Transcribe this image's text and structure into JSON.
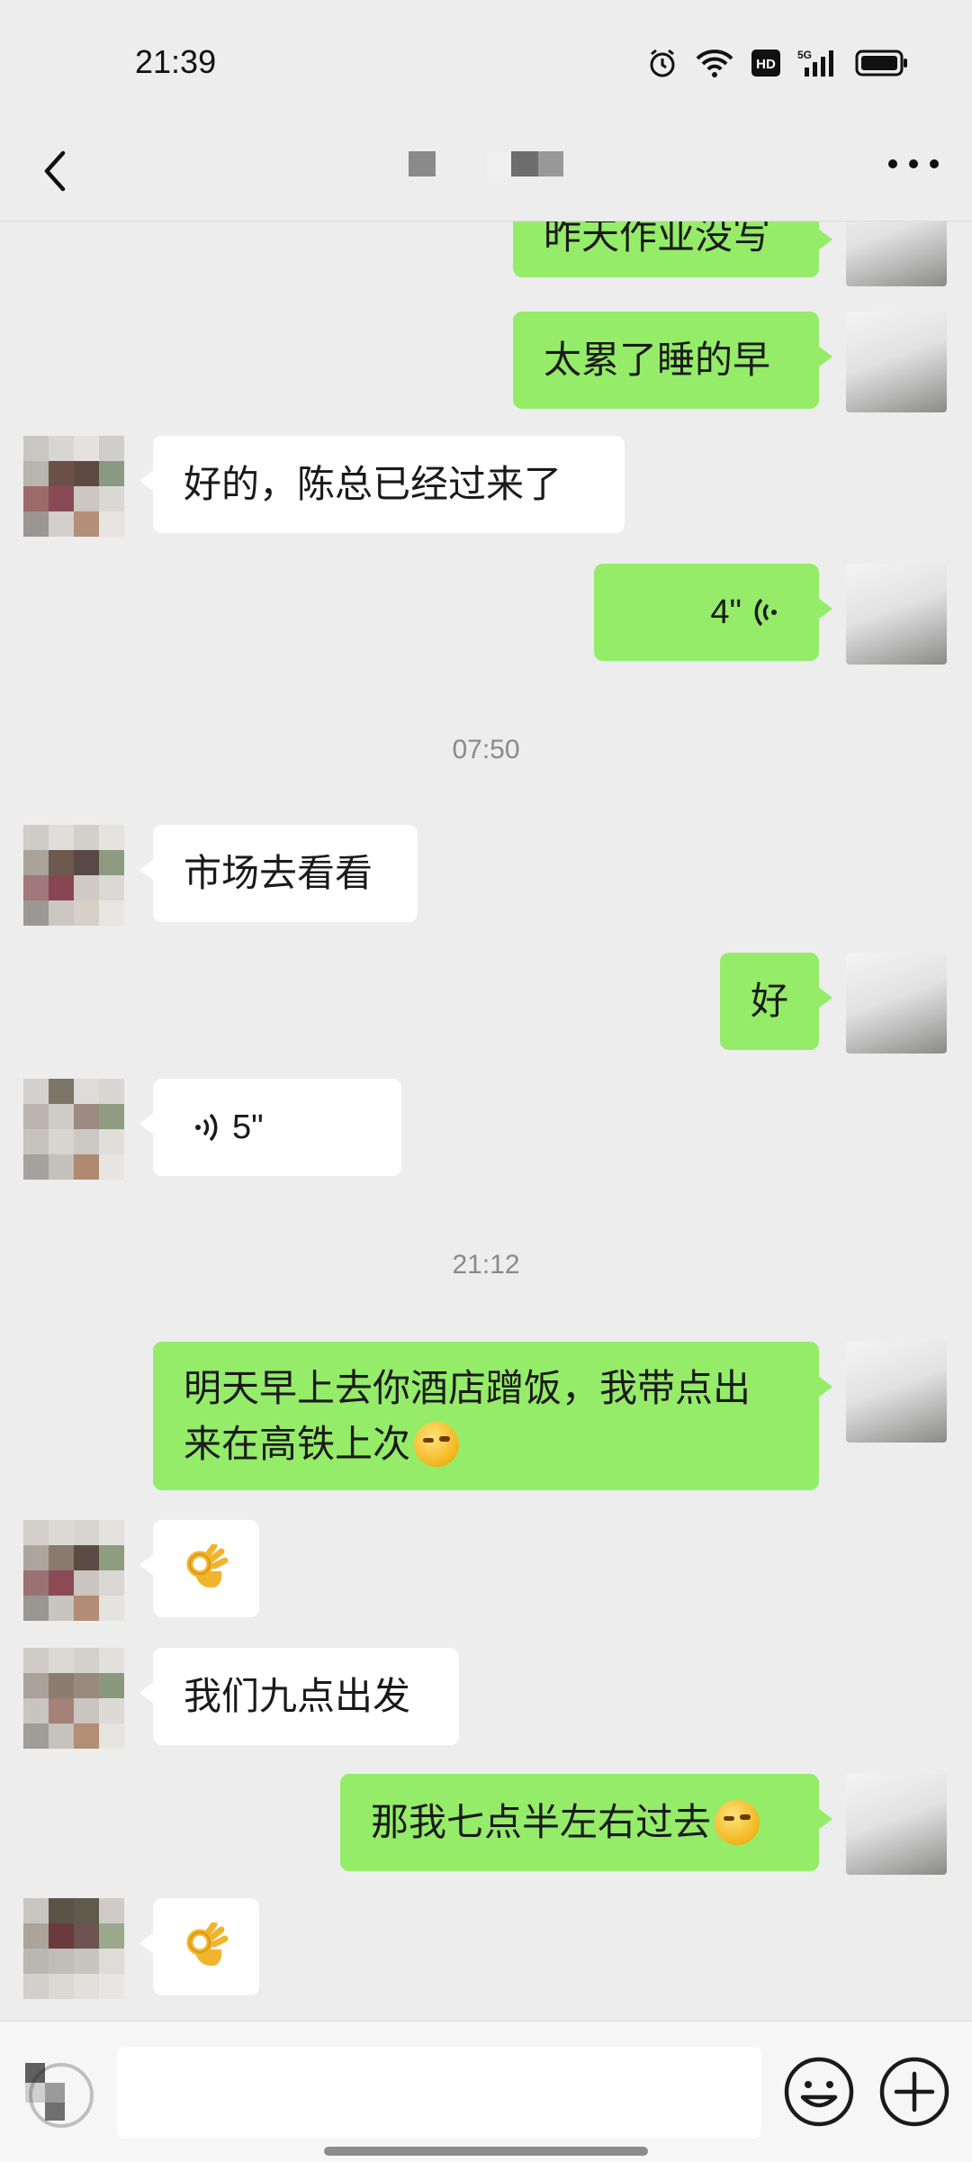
{
  "status_bar": {
    "time": "21:39",
    "icons": [
      "alarm-icon",
      "wifi-icon",
      "hd-icon",
      "signal-5g-icon",
      "battery-icon"
    ]
  },
  "nav": {
    "back_icon": "chevron-left-icon",
    "more_icon": "more-dots-icon"
  },
  "messages": [
    {
      "side": "me",
      "type": "text",
      "text": "昨天作业没写"
    },
    {
      "side": "me",
      "type": "text",
      "text": "太累了睡的早"
    },
    {
      "side": "them",
      "type": "text",
      "text": "好的，陈总已经过来了"
    },
    {
      "side": "me",
      "type": "voice",
      "duration": "4\""
    },
    {
      "type": "timestamp",
      "text": "07:50"
    },
    {
      "side": "them",
      "type": "text",
      "text": "市场去看看"
    },
    {
      "side": "me",
      "type": "text",
      "text": "好"
    },
    {
      "side": "them",
      "type": "voice",
      "duration": "5\""
    },
    {
      "type": "timestamp",
      "text": "21:12"
    },
    {
      "side": "me",
      "type": "text",
      "text_line1": "明天早上去你酒店蹭饭，我带点出",
      "text_line2": "来在高铁上次",
      "emoji": "thinking-face-emoji"
    },
    {
      "side": "them",
      "type": "emoji",
      "emoji": "ok-hand-emoji"
    },
    {
      "side": "them",
      "type": "text",
      "text": "我们九点出发"
    },
    {
      "side": "me",
      "type": "text",
      "text": "那我七点半左右过去",
      "emoji": "thinking-face-emoji"
    },
    {
      "side": "them",
      "type": "emoji",
      "emoji": "ok-hand-emoji"
    }
  ],
  "input_bar": {
    "input_value": "",
    "icons": [
      "voice-toggle-icon",
      "emoji-icon",
      "plus-icon"
    ]
  }
}
